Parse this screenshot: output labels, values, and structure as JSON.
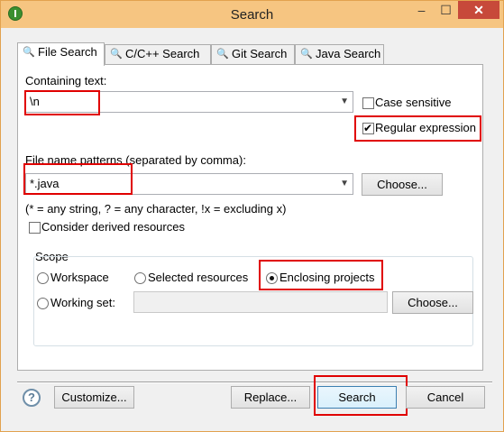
{
  "window": {
    "title": "Search",
    "minimize": "–",
    "maximize": "☐",
    "close": "✕"
  },
  "tabs": [
    {
      "label": "File Search",
      "icon": "file-search-icon"
    },
    {
      "label": "C/C++ Search",
      "icon": "cpp-search-icon"
    },
    {
      "label": "Git Search",
      "icon": "git-search-icon"
    },
    {
      "label": "Java Search",
      "icon": "java-search-icon"
    }
  ],
  "containing_text": {
    "label": "Containing text:",
    "value": "\\n"
  },
  "case_sensitive": {
    "label": "Case sensitive",
    "checked": false
  },
  "regular_expression": {
    "label": "Regular expression",
    "checked": true
  },
  "file_patterns": {
    "label": "File name patterns (separated by comma):",
    "value": "*.java",
    "choose_label": "Choose...",
    "hint": "(* = any string, ? = any character, !x = excluding x)"
  },
  "derived": {
    "label": "Consider derived resources",
    "checked": false
  },
  "scope": {
    "label": "Scope",
    "workspace": "Workspace",
    "selected_resources": "Selected resources",
    "enclosing_projects": "Enclosing projects",
    "working_set": "Working set:",
    "choose_label": "Choose...",
    "selected": "enclosing_projects"
  },
  "footer": {
    "help": "?",
    "customize": "Customize...",
    "replace": "Replace...",
    "search": "Search",
    "cancel": "Cancel"
  },
  "colors": {
    "highlight": "#e00000",
    "titlebar": "#f6c581",
    "close": "#c7493a"
  }
}
